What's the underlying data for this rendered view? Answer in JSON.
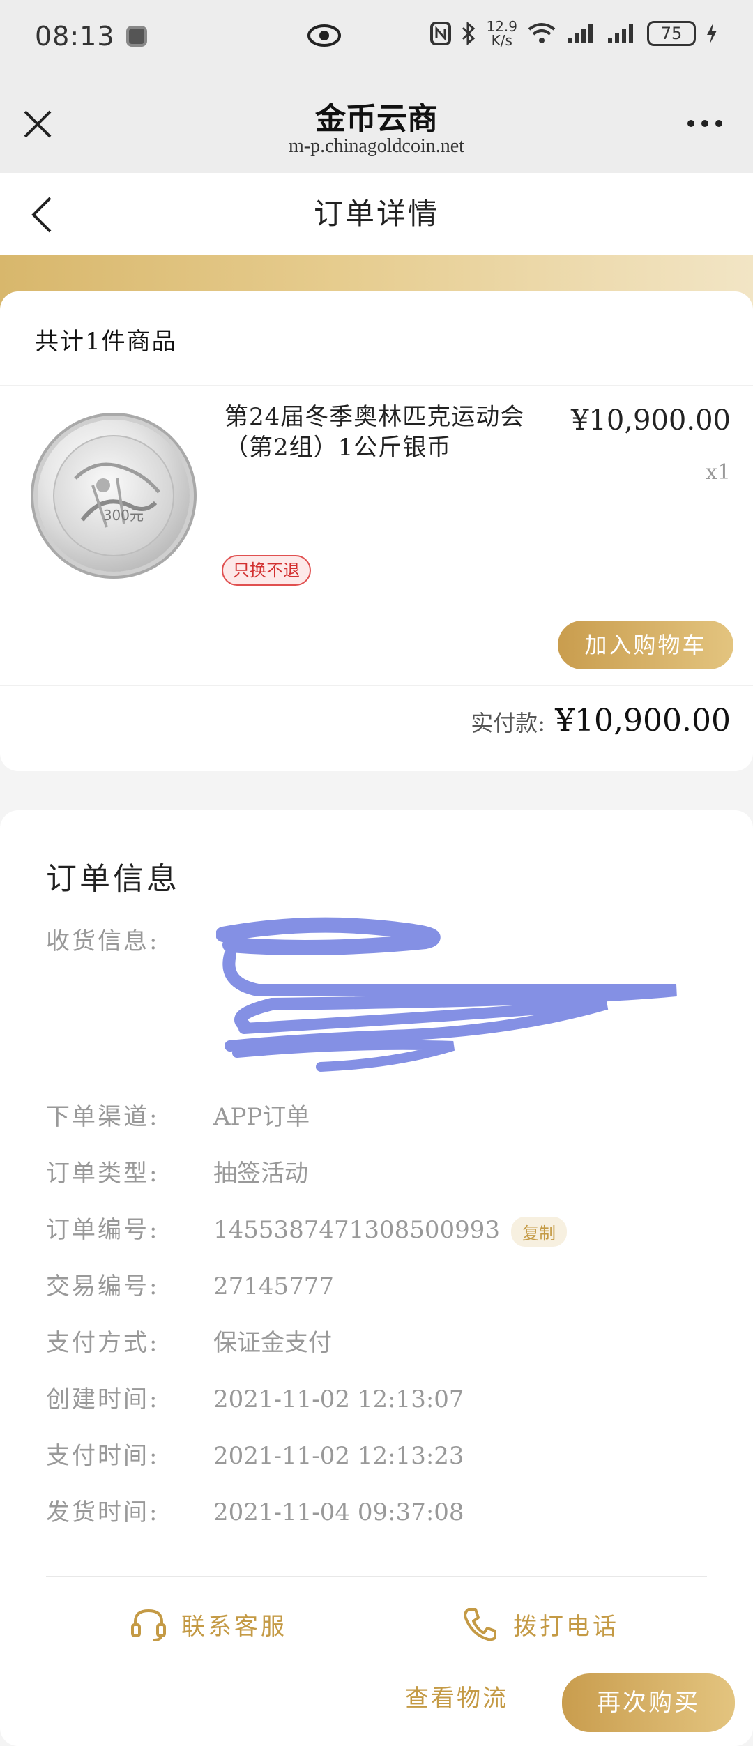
{
  "status_bar": {
    "time": "08:13",
    "speed_value": "12.9",
    "speed_unit": "K/s",
    "battery": "75"
  },
  "browser": {
    "site_name": "金币云商",
    "url": "m-p.chinagoldcoin.net"
  },
  "nav": {
    "title": "订单详情"
  },
  "items_card": {
    "count_label": "共计1件商品",
    "product": {
      "name": "第24届冬季奥林匹克运动会（第2组）1公斤银币",
      "price": "¥10,900.00",
      "quantity": "x1",
      "badge": "只换不退",
      "coin_denomination": "300元"
    },
    "add_to_cart_label": "加入购物车",
    "paid_label": "实付款:",
    "paid_amount": "¥10,900.00"
  },
  "order_info": {
    "title": "订单信息",
    "shipping_label": "收货信息:",
    "rows": [
      {
        "key": "下单渠道:",
        "value": "APP订单"
      },
      {
        "key": "订单类型:",
        "value": "抽签活动"
      },
      {
        "key": "订单编号:",
        "value": "1455387471308500993"
      },
      {
        "key": "交易编号:",
        "value": "27145777"
      },
      {
        "key": "支付方式:",
        "value": "保证金支付"
      },
      {
        "key": "创建时间:",
        "value": "2021-11-02 12:13:07"
      },
      {
        "key": "支付时间:",
        "value": "2021-11-02 12:13:23"
      },
      {
        "key": "发货时间:",
        "value": "2021-11-04 09:37:08"
      }
    ],
    "copy_label": "复制"
  },
  "actions": {
    "customer_service": "联系客服",
    "call_phone": "拨打电话",
    "view_logistics": "查看物流",
    "buy_again": "再次购买"
  },
  "colors": {
    "gold": "#c49a45",
    "badge_red": "#d23030",
    "background": "#f4f4f4"
  }
}
